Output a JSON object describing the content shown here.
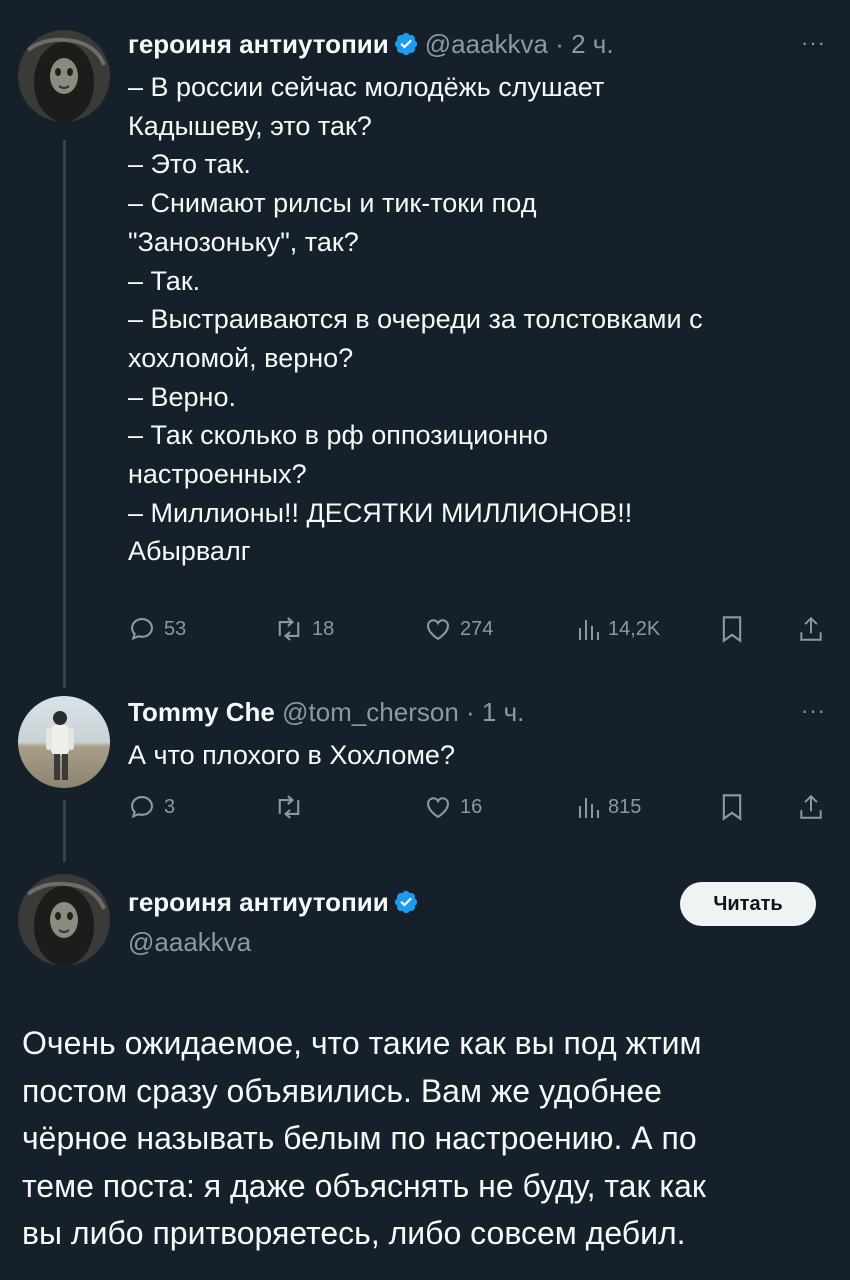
{
  "tweet1": {
    "author_name": "героиня антиутопии",
    "handle": "@aaakkva",
    "time": "· 2 ч.",
    "lines": [
      "– В россии сейчас молодёжь слушает",
      "Кадышеву, это так?",
      "– Это так.",
      "– Снимают рилсы и тик-токи под",
      "\"Занозоньку\", так?",
      "– Так.",
      "– Выстраиваются в очереди за толстовками с",
      "хохломой, верно?",
      "– Верно.",
      "– Так сколько в рф оппозиционно",
      "настроенных?",
      "– Миллионы!! ДЕСЯТКИ МИЛЛИОНОВ!!",
      "Абырвалг"
    ],
    "replies": "53",
    "reposts": "18",
    "likes": "274",
    "views": "14,2K"
  },
  "tweet2": {
    "author_name": "Tommy Che",
    "handle": "@tom_cherson",
    "time": "· 1 ч.",
    "text": "А что плохого в Хохломе?",
    "replies": "3",
    "reposts": "",
    "likes": "16",
    "views": "815"
  },
  "tweet3": {
    "author_name": "героиня антиутопии",
    "handle": "@aaakkva",
    "follow_label": "Читать",
    "lines": [
      "Очень ожидаемое, что такие как вы под жтим",
      "постом сразу объявились. Вам же удобнее",
      "чёрное называть белым по настроению. А по",
      "теме поста: я даже объяснять не буду, так как",
      "вы либо притворяетесь, либо совсем дебил."
    ]
  },
  "more_label": "···",
  "colors": {
    "background": "#15202b",
    "text": "#f7f9f9",
    "secondary": "#8b98a5",
    "verified": "#1d9bf0",
    "thread_line": "#38444d"
  }
}
